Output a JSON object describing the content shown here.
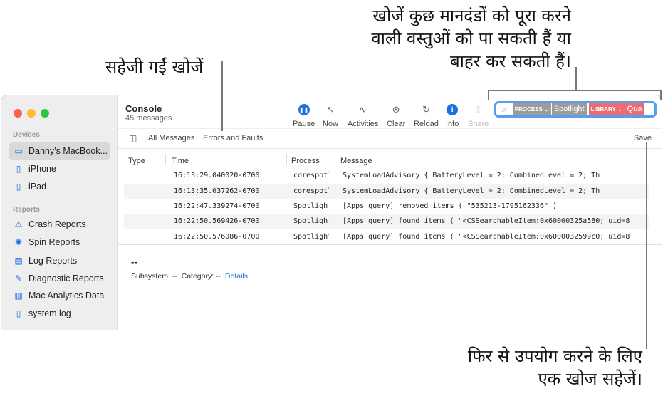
{
  "annotations": {
    "search": [
      "खोजें कुछ मानदंडों को पूरा करने",
      "वाली वस्तुओं को पा सकती हैं या",
      "बाहर कर सकती हैं।"
    ],
    "saved": "सहेजी गईं खोजें",
    "save": [
      "फिर से उपयोग करने के लिए",
      "एक खोज सहेजें।"
    ]
  },
  "sidebar": {
    "devices_header": "Devices",
    "devices": [
      {
        "label": "Danny’s MacBook...",
        "icon": "laptop-icon",
        "selected": true
      },
      {
        "label": "iPhone",
        "icon": "iphone-icon"
      },
      {
        "label": "iPad",
        "icon": "ipad-icon"
      }
    ],
    "reports_header": "Reports",
    "reports": [
      {
        "label": "Crash Reports",
        "icon": "warning-icon"
      },
      {
        "label": "Spin Reports",
        "icon": "spin-icon"
      },
      {
        "label": "Log Reports",
        "icon": "document-icon"
      },
      {
        "label": "Diagnostic Reports",
        "icon": "wrench-icon"
      },
      {
        "label": "Mac Analytics Data",
        "icon": "chart-icon"
      },
      {
        "label": "system.log",
        "icon": "file-icon"
      }
    ]
  },
  "header": {
    "title": "Console",
    "subtitle": "45 messages"
  },
  "toolbar": [
    {
      "label": "Pause",
      "icon": "pause-icon"
    },
    {
      "label": "Now",
      "icon": "now-icon"
    },
    {
      "label": "Activities",
      "icon": "activities-icon"
    },
    {
      "label": "Clear",
      "icon": "clear-icon"
    },
    {
      "label": "Reload",
      "icon": "reload-icon"
    },
    {
      "label": "Info",
      "icon": "info-icon"
    },
    {
      "label": "Share",
      "icon": "share-icon",
      "disabled": true
    }
  ],
  "search": {
    "tokens": [
      {
        "type": "PROCESS",
        "value": "Spotlight",
        "color": "#9c9d9b"
      },
      {
        "type": "LIBRARY",
        "value": "Qua",
        "color": "#ec6d6f"
      }
    ],
    "accent": "#5a9cf0"
  },
  "filters": {
    "all": "All Messages",
    "errors": "Errors and Faults",
    "save": "Save"
  },
  "columns": [
    "Type",
    "Time",
    "Process",
    "Message"
  ],
  "rows": [
    {
      "time": "16:13:29.040020-0700",
      "process": "corespotl",
      "message": "SystemLoadAdvisory {     BatteryLevel = 2;     CombinedLevel = 2;     Th"
    },
    {
      "time": "16:13:35.037262-0700",
      "process": "corespotl",
      "message": "SystemLoadAdvisory {     BatteryLevel = 2;     CombinedLevel = 2;     Th"
    },
    {
      "time": "16:22:47.339274-0700",
      "process": "Spotlight",
      "message": "[Apps query] removed items (     \"535213-1795162336\" )"
    },
    {
      "time": "16:22:50.569426-0700",
      "process": "Spotlight",
      "message": "[Apps query] found items (     \"<CSSearchableItem:0x60000325a580; uid=8"
    },
    {
      "time": "16:22:50.576086-0700",
      "process": "Spotlight",
      "message": "[Apps query] found items (     \"<CSSearchableItem:0x6000032599c0; uid=8"
    }
  ],
  "detail": {
    "title": "--",
    "subsystem": "Subsystem: --",
    "category": "Category: --",
    "details_link": "Details"
  }
}
